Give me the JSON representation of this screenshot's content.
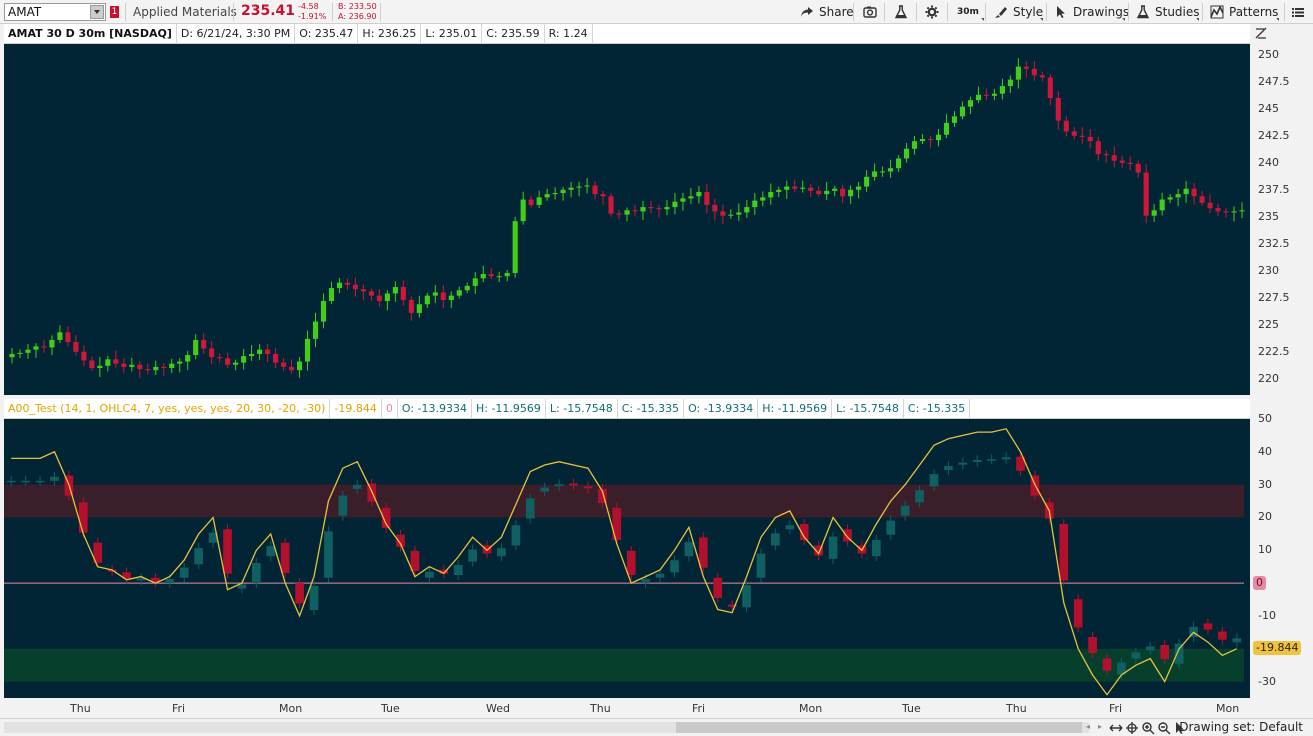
{
  "toolbar": {
    "symbol": "AMAT",
    "alert_count": "1",
    "company": "Applied Materials",
    "last_price": "235.41",
    "net_change": "-4.58",
    "pct_change": "-1.91%",
    "bid": "B: 233.50",
    "ask": "A: 236.90",
    "share_label": "Share",
    "timeframe_label": "30m",
    "style_label": "Style",
    "drawings_label": "Drawings",
    "studies_label": "Studies",
    "patterns_label": "Patterns"
  },
  "price_header": {
    "title": "AMAT 30 D 30m [NASDAQ]",
    "date": "D: 6/21/24, 3:30 PM",
    "open": "O: 235.47",
    "high": "H: 236.25",
    "low": "L: 235.01",
    "close": "C: 235.59",
    "range": "R: 1.24"
  },
  "study_header": {
    "name": "A00_Test (14, 1, OHLC4, 7, yes, yes, yes, 20, 30, -20, -30)",
    "value": "-19.844",
    "zero": "0",
    "o1": "O: -13.9334",
    "h1": "H: -11.9569",
    "l1": "L: -15.7548",
    "c1": "C: -15.335",
    "o2": "O: -13.9334",
    "h2": "H: -11.9569",
    "l2": "L: -15.7548",
    "c2": "C: -15.335"
  },
  "price_axis": [
    "250",
    "247.5",
    "245",
    "242.5",
    "240",
    "237.5",
    "235",
    "232.5",
    "230",
    "227.5",
    "225",
    "222.5",
    "220"
  ],
  "study_axis": [
    "50",
    "40",
    "30",
    "20",
    "10",
    "-10",
    "-30"
  ],
  "study_tags": {
    "zero": "0",
    "value": "-19.844"
  },
  "x_axis": [
    "Thu",
    "Fri",
    "Mon",
    "Tue",
    "Wed",
    "Thu",
    "Fri",
    "Mon",
    "Tue",
    "Thu",
    "Fri",
    "Mon"
  ],
  "status": {
    "drawing_set": "Drawing set: Default"
  },
  "colors": {
    "background": "#022536",
    "up": "#3fcf1a",
    "down": "#d0173a",
    "study_up": "#0f5f63",
    "study_down": "#b3102d",
    "study_line": "#e8c23a",
    "ob_zone": "#3a1f2a",
    "os_zone": "#06402c",
    "zero_line": "#e48ca6"
  },
  "chart_data": [
    {
      "type": "candlestick",
      "name": "price",
      "ylim": [
        218.5,
        251
      ],
      "close": [
        222.3,
        222.4,
        222.7,
        223.0,
        222.9,
        223.6,
        224.3,
        223.4,
        222.5,
        221.7,
        221.0,
        221.2,
        221.8,
        221.4,
        221.1,
        221.3,
        220.9,
        220.8,
        221.1,
        221.0,
        221.4,
        221.6,
        222.2,
        223.6,
        222.8,
        222.0,
        221.9,
        221.3,
        221.5,
        222.1,
        222.3,
        222.7,
        222.3,
        221.5,
        221.1,
        220.8,
        221.6,
        223.7,
        225.3,
        227.2,
        228.4,
        228.9,
        228.7,
        228.3,
        228.1,
        227.7,
        227.2,
        227.9,
        228.5,
        227.3,
        226.1,
        226.9,
        227.7,
        228.0,
        227.3,
        227.7,
        228.2,
        228.6,
        229.3,
        229.7,
        229.5,
        229.5,
        229.8,
        234.6,
        236.6,
        236.1,
        236.8,
        237.1,
        237.2,
        237.5,
        237.7,
        237.8,
        237.9,
        237.1,
        236.9,
        235.3,
        235.2,
        235.6,
        235.5,
        235.9,
        235.8,
        235.7,
        235.9,
        236.4,
        236.7,
        236.9,
        237.3,
        236.1,
        235.5,
        235.1,
        235.2,
        235.4,
        235.9,
        236.5,
        236.8,
        237.3,
        237.5,
        237.8,
        237.6,
        237.7,
        237.4,
        237.1,
        237.4,
        237.6,
        236.9,
        237.5,
        237.8,
        238.7,
        239.2,
        239.2,
        239.5,
        240.4,
        241.3,
        242.0,
        242.2,
        242.1,
        242.6,
        243.7,
        244.3,
        245.2,
        245.8,
        246.3,
        246.2,
        246.4,
        247.1,
        247.7,
        248.9,
        248.7,
        248.1,
        247.9,
        246.0,
        243.9,
        242.9,
        242.5,
        242.4,
        242.0,
        240.8,
        240.7,
        240.2,
        240.0,
        239.9,
        239.1,
        235.1,
        235.6,
        236.6,
        236.8,
        237.1,
        237.6,
        236.9,
        236.3,
        235.8,
        235.5,
        235.4,
        235.5,
        235.6
      ]
    },
    {
      "type": "line",
      "name": "oscillator",
      "ylim": [
        -35,
        50
      ],
      "reference_lines": [
        0
      ],
      "zones": [
        [
          20,
          30
        ],
        [
          -30,
          -20
        ]
      ],
      "values": [
        38,
        38,
        38,
        40,
        30,
        15,
        5,
        4,
        1,
        2,
        0,
        2,
        7,
        15,
        20,
        -2,
        0,
        10,
        15,
        0,
        -10,
        2,
        25,
        35,
        37,
        28,
        18,
        12,
        2,
        5,
        3,
        8,
        14,
        10,
        14,
        24,
        34,
        36,
        37,
        36,
        35,
        28,
        12,
        0,
        2,
        4,
        10,
        17,
        2,
        -8,
        -9,
        2,
        14,
        20,
        22,
        14,
        9,
        20,
        14,
        10,
        18,
        25,
        30,
        36,
        42,
        44,
        45,
        46,
        46,
        47,
        40,
        30,
        22,
        -6,
        -20,
        -28,
        -34,
        -28,
        -25,
        -23,
        -30,
        -20,
        -15,
        -18,
        -22,
        -20
      ]
    }
  ]
}
